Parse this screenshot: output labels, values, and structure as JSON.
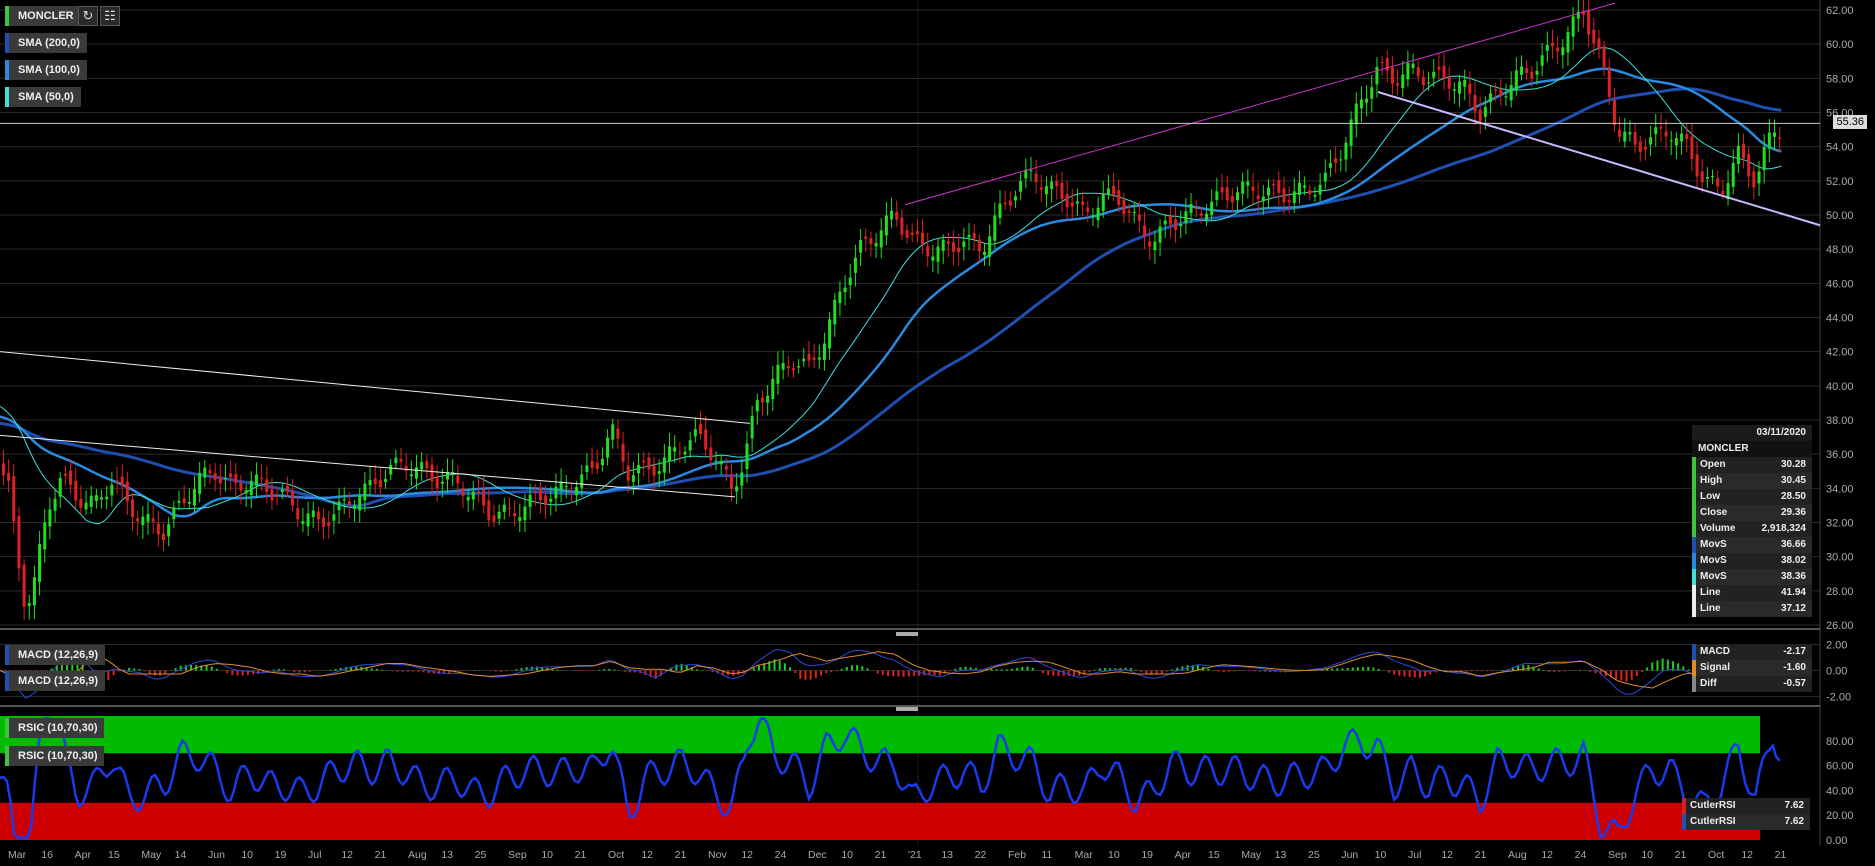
{
  "toolbar": {
    "symbol": "MONCLER",
    "indicators": [
      "SMA (200,0)",
      "SMA (100,0)",
      "SMA (50,0)"
    ],
    "indicator_colors": [
      "#1f4fb0",
      "#2a8ae0",
      "#3ee0d8"
    ],
    "refresh_icon": "refresh-icon",
    "calendar_icon": "calendar-icon"
  },
  "last_price": "55.36",
  "info_panel": {
    "date": "03/11/2020",
    "symbol": "MONCLER",
    "rows": [
      {
        "label": "Open",
        "value": "30.28",
        "color": "#3cc43c"
      },
      {
        "label": "High",
        "value": "30.45",
        "color": "#3cc43c"
      },
      {
        "label": "Low",
        "value": "28.50",
        "color": "#3cc43c"
      },
      {
        "label": "Close",
        "value": "29.36",
        "color": "#3cc43c"
      },
      {
        "label": "Volume",
        "value": "2,918,324",
        "color": "#3cc43c"
      },
      {
        "label": "MovS",
        "value": "36.66",
        "color": "#1f4fb0"
      },
      {
        "label": "MovS",
        "value": "38.02",
        "color": "#2a8ae0"
      },
      {
        "label": "MovS",
        "value": "38.36",
        "color": "#3ee0d8"
      },
      {
        "label": "Line",
        "value": "41.94",
        "color": "#eeeeee"
      },
      {
        "label": "Line",
        "value": "37.12",
        "color": "#eeeeee"
      }
    ]
  },
  "macd_panel": {
    "labels": [
      "MACD (12,26,9)",
      "MACD (12,26,9)"
    ],
    "rows": [
      {
        "label": "MACD",
        "value": "-2.17",
        "color": "#1f4fb0"
      },
      {
        "label": "Signal",
        "value": "-1.60",
        "color": "#e08a2a"
      },
      {
        "label": "Diff",
        "value": "-0.57",
        "color": "#888888"
      }
    ]
  },
  "rsi_panel": {
    "labels": [
      "RSIC (10,70,30)",
      "RSIC (10,70,30)"
    ],
    "rows": [
      {
        "label": "CutlerRSI",
        "value": "7.62",
        "color": "#cc2222"
      },
      {
        "label": "CutlerRSI",
        "value": "7.62",
        "color": "#1f4fb0"
      }
    ]
  },
  "chart_data": [
    {
      "type": "candlestick",
      "title": "MONCLER",
      "ylim": [
        26,
        62
      ],
      "yticks": [
        "62.00",
        "60.00",
        "58.00",
        "56.00",
        "54.00",
        "52.00",
        "50.00",
        "48.00",
        "46.00",
        "44.00",
        "42.00",
        "40.00",
        "38.00",
        "36.00",
        "34.00",
        "32.00",
        "30.00",
        "28.00",
        "26.00"
      ],
      "xticks": [
        "Mar",
        "16",
        "Apr",
        "15",
        "May",
        "14",
        "Jun",
        "10",
        "19",
        "Jul",
        "12",
        "21",
        "Aug",
        "13",
        "25",
        "Sep",
        "10",
        "21",
        "Oct",
        "12",
        "21",
        "Nov",
        "12",
        "24",
        "Dec",
        "10",
        "21",
        "'21",
        "13",
        "22",
        "Feb",
        "11",
        "Mar",
        "10",
        "19",
        "Apr",
        "15",
        "May",
        "13",
        "25",
        "Jun",
        "10",
        "Jul",
        "12",
        "21",
        "Aug",
        "12",
        "24",
        "Sep",
        "10",
        "21",
        "Oct",
        "12",
        "21"
      ],
      "close_path": [
        [
          0,
          35.5
        ],
        [
          5,
          34
        ],
        [
          10,
          30
        ],
        [
          15,
          27
        ],
        [
          20,
          28.5
        ],
        [
          28,
          33
        ],
        [
          35,
          34.5
        ],
        [
          45,
          33.5
        ],
        [
          55,
          33
        ],
        [
          65,
          34.5
        ],
        [
          75,
          33
        ],
        [
          85,
          32
        ],
        [
          95,
          31.5
        ],
        [
          105,
          33
        ],
        [
          115,
          34.5
        ],
        [
          125,
          35
        ],
        [
          135,
          34
        ],
        [
          145,
          34.5
        ],
        [
          155,
          34
        ],
        [
          165,
          33.5
        ],
        [
          175,
          32.5
        ],
        [
          185,
          32
        ],
        [
          195,
          32.5
        ],
        [
          205,
          33.5
        ],
        [
          215,
          34
        ],
        [
          225,
          35
        ],
        [
          235,
          35.5
        ],
        [
          245,
          35
        ],
        [
          255,
          34.5
        ],
        [
          265,
          34.5
        ],
        [
          275,
          33.5
        ],
        [
          285,
          32.5
        ],
        [
          295,
          32.5
        ],
        [
          305,
          33
        ],
        [
          315,
          33.5
        ],
        [
          325,
          33.8
        ],
        [
          335,
          34.5
        ],
        [
          345,
          35
        ],
        [
          355,
          37.5
        ],
        [
          365,
          35
        ],
        [
          375,
          35
        ],
        [
          385,
          35.5
        ],
        [
          395,
          36.5
        ],
        [
          405,
          37
        ],
        [
          415,
          36
        ],
        [
          425,
          34
        ],
        [
          432,
          35.5
        ],
        [
          440,
          39
        ],
        [
          450,
          40.5
        ],
        [
          460,
          41.5
        ],
        [
          470,
          41
        ],
        [
          480,
          43
        ],
        [
          490,
          46
        ],
        [
          500,
          48
        ],
        [
          510,
          49
        ],
        [
          520,
          50
        ],
        [
          530,
          48.5
        ],
        [
          540,
          48
        ],
        [
          550,
          48
        ],
        [
          560,
          48.5
        ],
        [
          570,
          48
        ],
        [
          580,
          50
        ],
        [
          590,
          51.5
        ],
        [
          600,
          52.5
        ],
        [
          610,
          51.5
        ],
        [
          620,
          51
        ],
        [
          630,
          50
        ],
        [
          640,
          51
        ],
        [
          650,
          51
        ],
        [
          660,
          49.5
        ],
        [
          670,
          48.5
        ],
        [
          680,
          49.5
        ],
        [
          690,
          50
        ],
        [
          700,
          50.5
        ],
        [
          710,
          51
        ],
        [
          720,
          51.5
        ],
        [
          730,
          51.5
        ],
        [
          740,
          51.2
        ],
        [
          750,
          51.2
        ],
        [
          760,
          51.5
        ],
        [
          770,
          52
        ],
        [
          780,
          54
        ],
        [
          790,
          56.5
        ],
        [
          800,
          58.5
        ],
        [
          810,
          58
        ],
        [
          820,
          58.5
        ],
        [
          830,
          58
        ],
        [
          840,
          58
        ],
        [
          850,
          57.5
        ],
        [
          860,
          56
        ],
        [
          870,
          57
        ],
        [
          880,
          58
        ],
        [
          890,
          58.5
        ],
        [
          900,
          59.5
        ],
        [
          910,
          60.5
        ],
        [
          920,
          62
        ],
        [
          930,
          59
        ],
        [
          940,
          55
        ],
        [
          950,
          54
        ],
        [
          960,
          54.5
        ],
        [
          970,
          55
        ],
        [
          980,
          54
        ],
        [
          990,
          52
        ],
        [
          1000,
          51.5
        ],
        [
          1010,
          53.5
        ],
        [
          1020,
          52
        ],
        [
          1030,
          55
        ]
      ],
      "sma_50_shape": "teal",
      "sma_100_shape": "blue",
      "sma_200_shape": "navy",
      "last": 55.36
    },
    {
      "type": "line",
      "title": "MACD (12,26,9)",
      "ylim": [
        -2.5,
        2.5
      ],
      "yticks": [
        "2.00",
        "0.00",
        "-2.00"
      ]
    },
    {
      "type": "line",
      "title": "RSIC (10,70,30)",
      "ylim": [
        0,
        100
      ],
      "yticks": [
        "80.00",
        "60.00",
        "40.00",
        "20.00",
        "0.00"
      ],
      "overbought": 70,
      "oversold": 30
    }
  ]
}
